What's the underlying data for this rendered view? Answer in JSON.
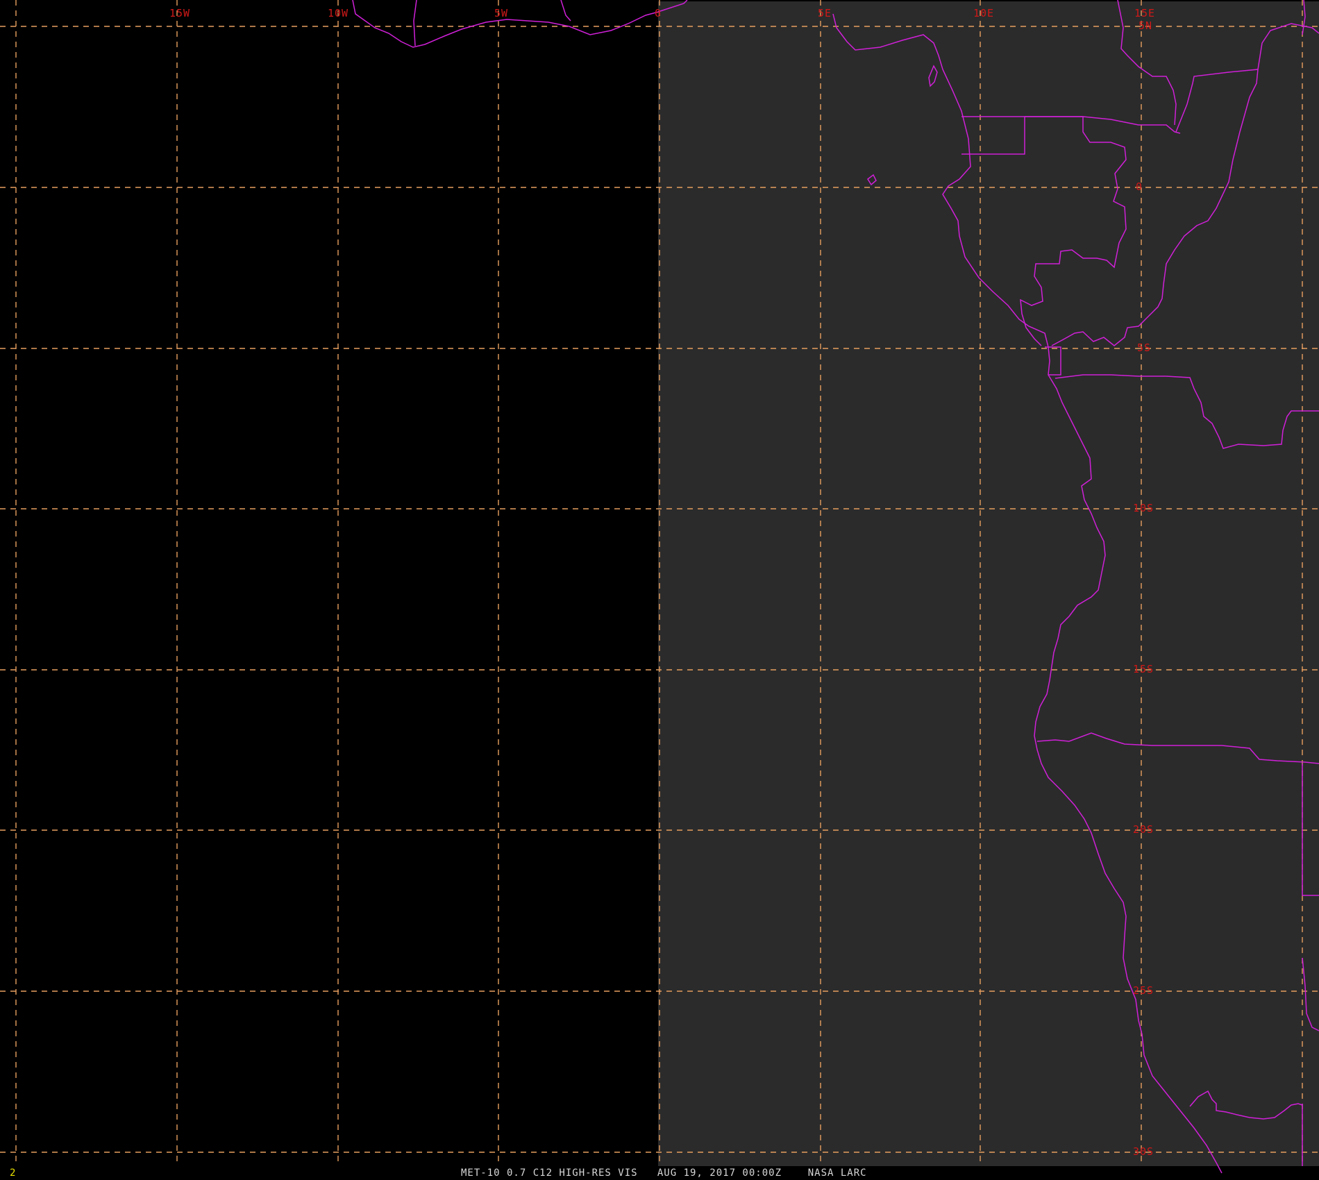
{
  "map": {
    "satellite_panel_color": "#2b2b2b",
    "grid_color": "#e8a060",
    "boundary_color": "#d020d8",
    "label_color": "#d01818",
    "lon_labels": [
      "15W",
      "10W",
      "5W",
      "0",
      "5E",
      "10E",
      "15E"
    ],
    "lat_labels": [
      "5N",
      "0",
      "5S",
      "10S",
      "15S",
      "20S",
      "25S",
      "30S"
    ]
  },
  "footer": {
    "frame": "2",
    "caption": "MET-10 0.7 C12 HIGH-RES VIS   AUG 19, 2017 00:00Z    NASA LARC"
  }
}
